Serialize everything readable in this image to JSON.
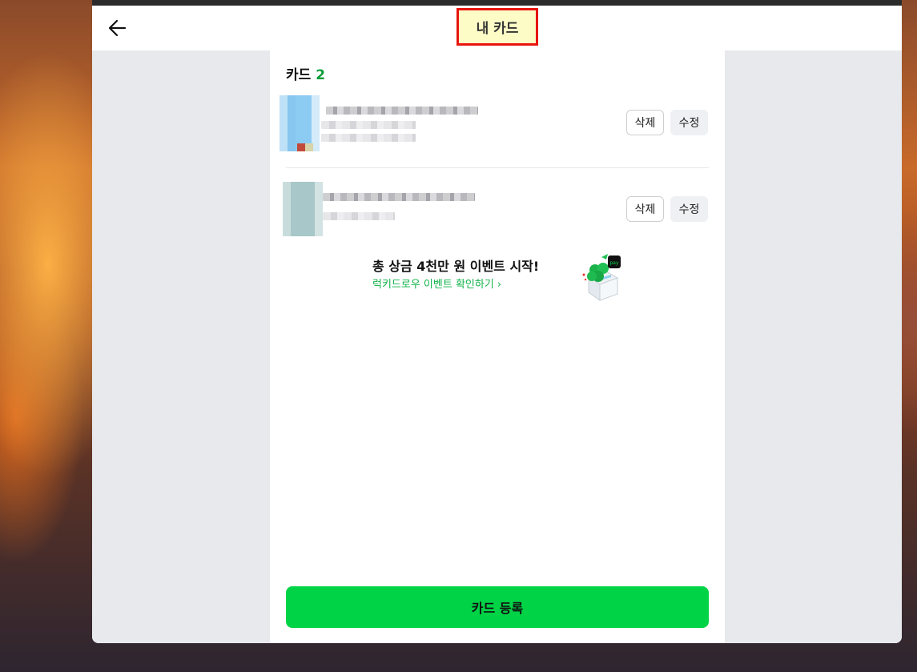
{
  "header": {
    "title": "내 카드"
  },
  "section": {
    "label": "카드",
    "count": "2"
  },
  "cards": [
    {
      "delete_label": "삭제",
      "edit_label": "수정"
    },
    {
      "delete_label": "삭제",
      "edit_label": "수정"
    }
  ],
  "event": {
    "title": "총 상금 4천만 원 이벤트 시작!",
    "link": "럭키드로우 이벤트 확인하기 ›"
  },
  "footer": {
    "register_label": "카드 등록"
  },
  "colors": {
    "accent": "#00d346",
    "count_green": "#0b9b3a",
    "link_green": "#11b34a",
    "highlight_border": "#e8150f",
    "highlight_bg": "#fdfbc6"
  },
  "icons": {
    "back": "back-arrow-icon",
    "gift": "gift-box-icon"
  }
}
